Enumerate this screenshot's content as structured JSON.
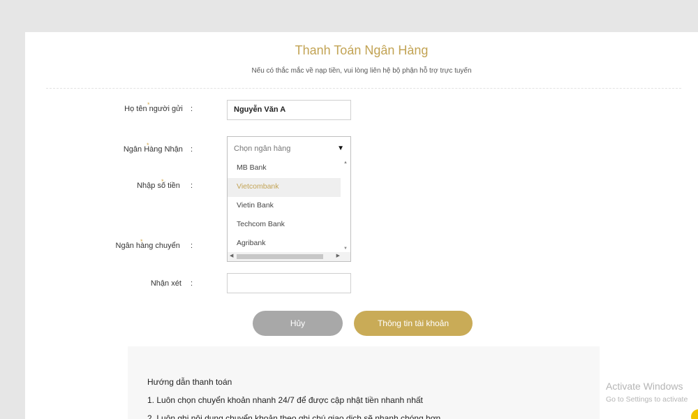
{
  "page": {
    "title": "Thanh Toán Ngân Hàng",
    "subtitle": "Nếu có thắc mắc về nạp tiền, vui lòng liên hệ bộ phận hỗ trợ trực tuyến"
  },
  "form": {
    "sender_name": {
      "label": "Họ tên người gửi",
      "value": "Nguyễn Văn A"
    },
    "receiving_bank": {
      "label": "Ngân Hàng Nhận",
      "placeholder": "Chọn ngân hàng",
      "options": [
        "MB Bank",
        "Vietcombank",
        "Vietin Bank",
        "Techcom Bank",
        "Agribank"
      ],
      "highlighted": "Vietcombank"
    },
    "amount": {
      "label": "Nhập số tiền"
    },
    "sending_bank": {
      "label": "Ngân hàng chuyển"
    },
    "comment": {
      "label": "Nhận xét",
      "value": ""
    },
    "separator": ":",
    "required_mark": "*"
  },
  "buttons": {
    "cancel": "Hủy",
    "account_info": "Thông tin tài khoản"
  },
  "guide": {
    "title": "Hướng dẫn thanh toán",
    "steps": [
      "1. Luôn chọn chuyển khoản nhanh 24/7 để được cập nhật tiền nhanh nhất",
      "2. Luôn ghi nội dung chuyển khoản theo ghi chú giao dịch sẽ nhanh chóng hơn"
    ]
  },
  "os_watermark": {
    "title": "Activate Windows",
    "subtitle": "Go to Settings to activate"
  },
  "colors": {
    "accent": "#c9ab57",
    "title": "#c2a354",
    "cancel_button": "#a8a8a8",
    "page_bg": "#e6e6e6"
  }
}
